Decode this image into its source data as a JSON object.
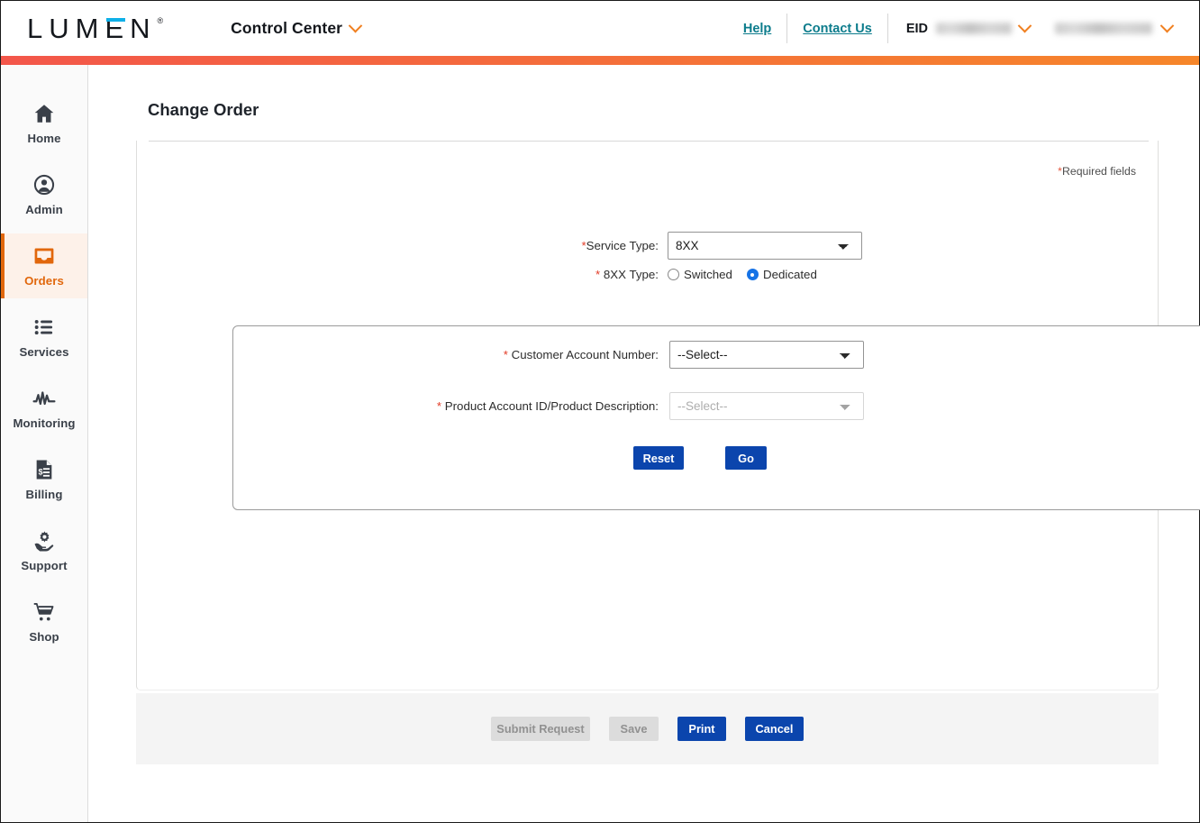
{
  "header": {
    "logo_text": "LUMEN",
    "logo_registered": "®",
    "app_title": "Control Center",
    "help_label": "Help",
    "contact_label": "Contact Us",
    "eid_label": "EID",
    "eid_value": "",
    "user_value": "",
    "accent_start": "#f3564a",
    "accent_end": "#f6862a",
    "link_color": "#0c7c8c"
  },
  "sidebar": {
    "active": "Orders",
    "items": [
      {
        "label": "Home",
        "icon": "home-icon"
      },
      {
        "label": "Admin",
        "icon": "user-circle-icon"
      },
      {
        "label": "Orders",
        "icon": "inbox-icon"
      },
      {
        "label": "Services",
        "icon": "list-icon"
      },
      {
        "label": "Monitoring",
        "icon": "pulse-icon"
      },
      {
        "label": "Billing",
        "icon": "invoice-icon"
      },
      {
        "label": "Support",
        "icon": "gear-hand-icon"
      },
      {
        "label": "Shop",
        "icon": "cart-icon"
      }
    ]
  },
  "main": {
    "page_title": "Change Order",
    "required_note_star": "*",
    "required_note": "Required fields",
    "service_type": {
      "label_star": "*",
      "label": "Service Type:",
      "value": "8XX",
      "options": [
        "8XX"
      ]
    },
    "eightxx_type": {
      "label_star": "*",
      "label": "8XX Type:",
      "options": [
        {
          "label": "Switched",
          "selected": false
        },
        {
          "label": "Dedicated",
          "selected": true
        }
      ]
    },
    "customer_account": {
      "label_star": "*",
      "label": "Customer Account Number:",
      "value": "--Select--",
      "options": [
        "--Select--"
      ]
    },
    "product_account": {
      "label_star": "*",
      "label": "Product Account ID/Product Description:",
      "value": "--Select--",
      "options": [
        "--Select--"
      ],
      "disabled": true
    },
    "panel_buttons": {
      "reset_label": "Reset",
      "go_label": "Go"
    }
  },
  "footer": {
    "submit_label": "Submit Request",
    "submit_disabled": true,
    "save_label": "Save",
    "save_disabled": true,
    "print_label": "Print",
    "cancel_label": "Cancel",
    "primary_color": "#0b45ad"
  }
}
